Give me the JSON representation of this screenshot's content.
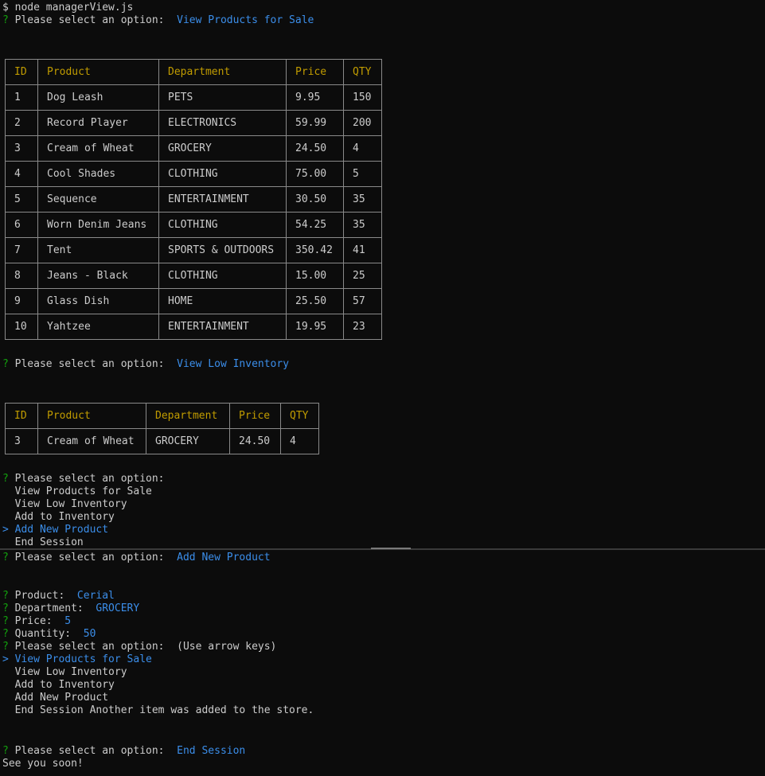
{
  "top": {
    "command": "$ node managerView.js",
    "prompt1": {
      "mark": "?",
      "question": " Please select an option:  ",
      "answer": "View Products for Sale"
    },
    "table1": {
      "headers": [
        "ID",
        "Product",
        "Department",
        "Price",
        "QTY"
      ],
      "rows": [
        [
          "1",
          "Dog Leash",
          "PETS",
          "9.95",
          "150"
        ],
        [
          "2",
          "Record Player",
          "ELECTRONICS",
          "59.99",
          "200"
        ],
        [
          "3",
          "Cream of Wheat",
          "GROCERY",
          "24.50",
          "4"
        ],
        [
          "4",
          "Cool Shades",
          "CLOTHING",
          "75.00",
          "5"
        ],
        [
          "5",
          "Sequence",
          "ENTERTAINMENT",
          "30.50",
          "35"
        ],
        [
          "6",
          "Worn Denim Jeans",
          "CLOTHING",
          "54.25",
          "35"
        ],
        [
          "7",
          "Tent",
          "SPORTS & OUTDOORS",
          "350.42",
          "41"
        ],
        [
          "8",
          "Jeans - Black",
          "CLOTHING",
          "15.00",
          "25"
        ],
        [
          "9",
          "Glass Dish",
          "HOME",
          "25.50",
          "57"
        ],
        [
          "10",
          "Yahtzee",
          "ENTERTAINMENT",
          "19.95",
          "23"
        ]
      ]
    },
    "prompt2": {
      "mark": "?",
      "question": " Please select an option:  ",
      "answer": "View Low Inventory"
    },
    "table2": {
      "headers": [
        "ID",
        "Product",
        "Department",
        "Price",
        "QTY"
      ],
      "rows": [
        [
          "3",
          "Cream of Wheat",
          "GROCERY",
          "24.50",
          "4"
        ]
      ]
    },
    "prompt3": {
      "mark": "?",
      "question": " Please select an option:"
    },
    "menu": {
      "cursor": ">",
      "items": [
        "View Products for Sale",
        "View Low Inventory",
        "Add to Inventory",
        "Add New Product",
        "End Session"
      ]
    }
  },
  "bottom": {
    "prompt4": {
      "mark": "?",
      "question": " Please select an option:  ",
      "answer": "Add New Product"
    },
    "product": {
      "mark": "?",
      "question": " Product:  ",
      "answer": "Cerial"
    },
    "department": {
      "mark": "?",
      "question": " Department:  ",
      "answer": "GROCERY"
    },
    "price": {
      "mark": "?",
      "question": " Price:  ",
      "answer": "5"
    },
    "quantity": {
      "mark": "?",
      "question": " Quantity:  ",
      "answer": "50"
    },
    "prompt5": {
      "mark": "?",
      "question": " Please select an option:  ",
      "hint": "(Use arrow keys)"
    },
    "menu": {
      "cursor": ">",
      "items": [
        "View Products for Sale",
        "View Low Inventory",
        "Add to Inventory",
        "Add New Product"
      ],
      "last_item": "End Session",
      "message": " Another item was added to the store."
    },
    "prompt6": {
      "mark": "?",
      "question": " Please select an option:  ",
      "answer": "End Session"
    },
    "farewell": "See you soon!"
  },
  "colors": {
    "background": "#0c0c0c",
    "text": "#cccccc",
    "prompt_mark": "#13a10e",
    "answer": "#3b8eea",
    "table_header": "#c19c00",
    "table_border": "#8a8a8a"
  }
}
